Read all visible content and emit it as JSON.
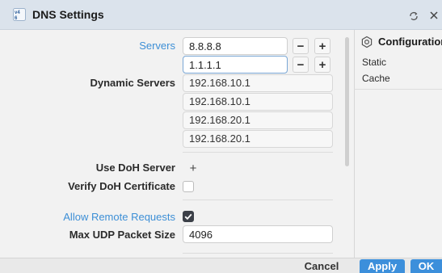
{
  "window": {
    "title": "DNS Settings",
    "app_icon": "dns-icon",
    "refresh_icon": "refresh-icon",
    "close_icon": "close-icon"
  },
  "form": {
    "servers_label": "Servers",
    "servers": [
      "8.8.8.8",
      "1.1.1.1"
    ],
    "dynamic_servers_label": "Dynamic Servers",
    "dynamic_servers": [
      "192.168.10.1",
      "192.168.10.1",
      "192.168.20.1",
      "192.168.20.1"
    ],
    "use_doh_label": "Use DoH Server",
    "verify_doh_label": "Verify DoH Certificate",
    "verify_doh_checked": false,
    "allow_remote_label": "Allow Remote Requests",
    "allow_remote_checked": true,
    "max_udp_label": "Max UDP Packet Size",
    "max_udp_value": "4096",
    "add_symbol": "+",
    "remove_symbol": "−"
  },
  "side_panel": {
    "title": "Configuration",
    "icon": "settings-icon",
    "items": [
      "Static",
      "Cache"
    ]
  },
  "buttons": {
    "cancel": "Cancel",
    "apply": "Apply",
    "ok": "OK"
  },
  "colors": {
    "accent": "#3c8fdb",
    "label_blue": "#3d8fd6",
    "titlebar": "#dbe3ec"
  }
}
